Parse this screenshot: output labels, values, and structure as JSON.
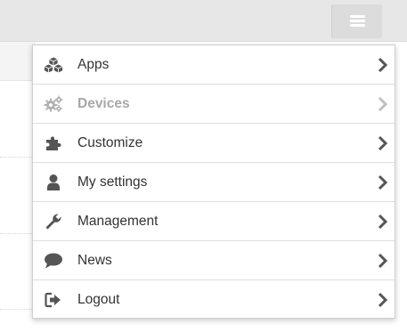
{
  "menu": {
    "items": [
      {
        "label": "Apps",
        "icon": "cubes-icon",
        "disabled": false
      },
      {
        "label": "Devices",
        "icon": "gears-icon",
        "disabled": true
      },
      {
        "label": "Customize",
        "icon": "puzzle-icon",
        "disabled": false
      },
      {
        "label": "My settings",
        "icon": "user-icon",
        "disabled": false
      },
      {
        "label": "Management",
        "icon": "wrench-icon",
        "disabled": false
      },
      {
        "label": "News",
        "icon": "speech-bubble-icon",
        "disabled": false
      },
      {
        "label": "Logout",
        "icon": "sign-out-icon",
        "disabled": false
      }
    ]
  },
  "colors": {
    "topbar": "#e7e7e7",
    "icon": "#555555",
    "icon_disabled": "#b0b0b0",
    "text": "#333333",
    "text_disabled": "#a8a8a8"
  },
  "header": {
    "menu_button_icon": "hamburger-icon"
  }
}
